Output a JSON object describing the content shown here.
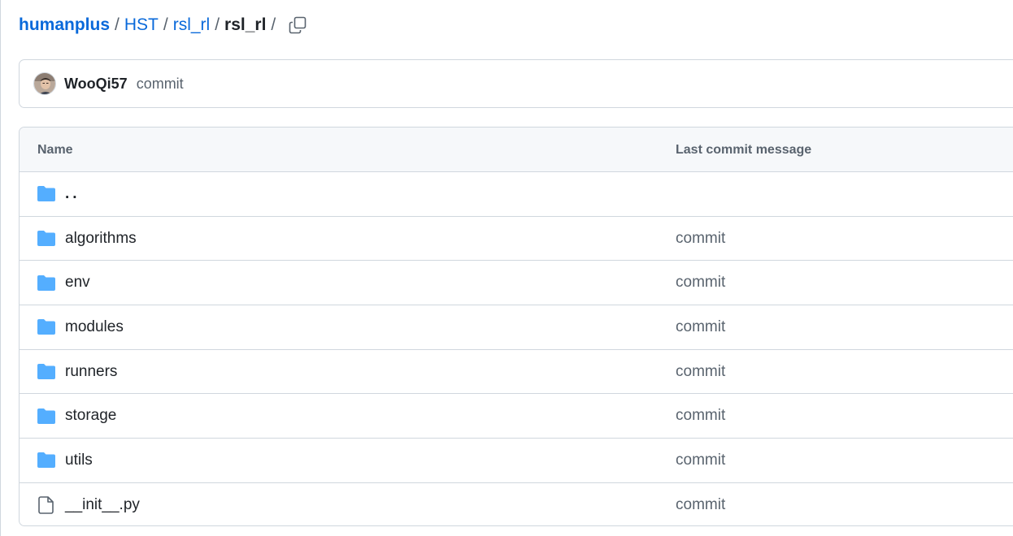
{
  "breadcrumb": {
    "owner": "humanplus",
    "items": [
      "HST",
      "rsl_rl"
    ],
    "current": "rsl_rl",
    "separator": "/"
  },
  "commit_bar": {
    "author": "WooQi57",
    "message": "commit"
  },
  "table": {
    "headers": {
      "name": "Name",
      "last_commit_message": "Last commit message"
    },
    "parent_label": "..",
    "rows": [
      {
        "name": "algorithms",
        "type": "folder",
        "message": "commit"
      },
      {
        "name": "env",
        "type": "folder",
        "message": "commit"
      },
      {
        "name": "modules",
        "type": "folder",
        "message": "commit"
      },
      {
        "name": "runners",
        "type": "folder",
        "message": "commit"
      },
      {
        "name": "storage",
        "type": "folder",
        "message": "commit"
      },
      {
        "name": "utils",
        "type": "folder",
        "message": "commit"
      },
      {
        "name": "__init__.py",
        "type": "file",
        "message": "commit"
      }
    ]
  },
  "colors": {
    "link": "#0969da",
    "folder": "#54aeff",
    "muted": "#59636e",
    "border": "#d0d7de",
    "header_bg": "#f6f8fa"
  },
  "icons": {
    "copy": "copy-icon",
    "folder": "folder-icon",
    "file": "file-icon"
  }
}
